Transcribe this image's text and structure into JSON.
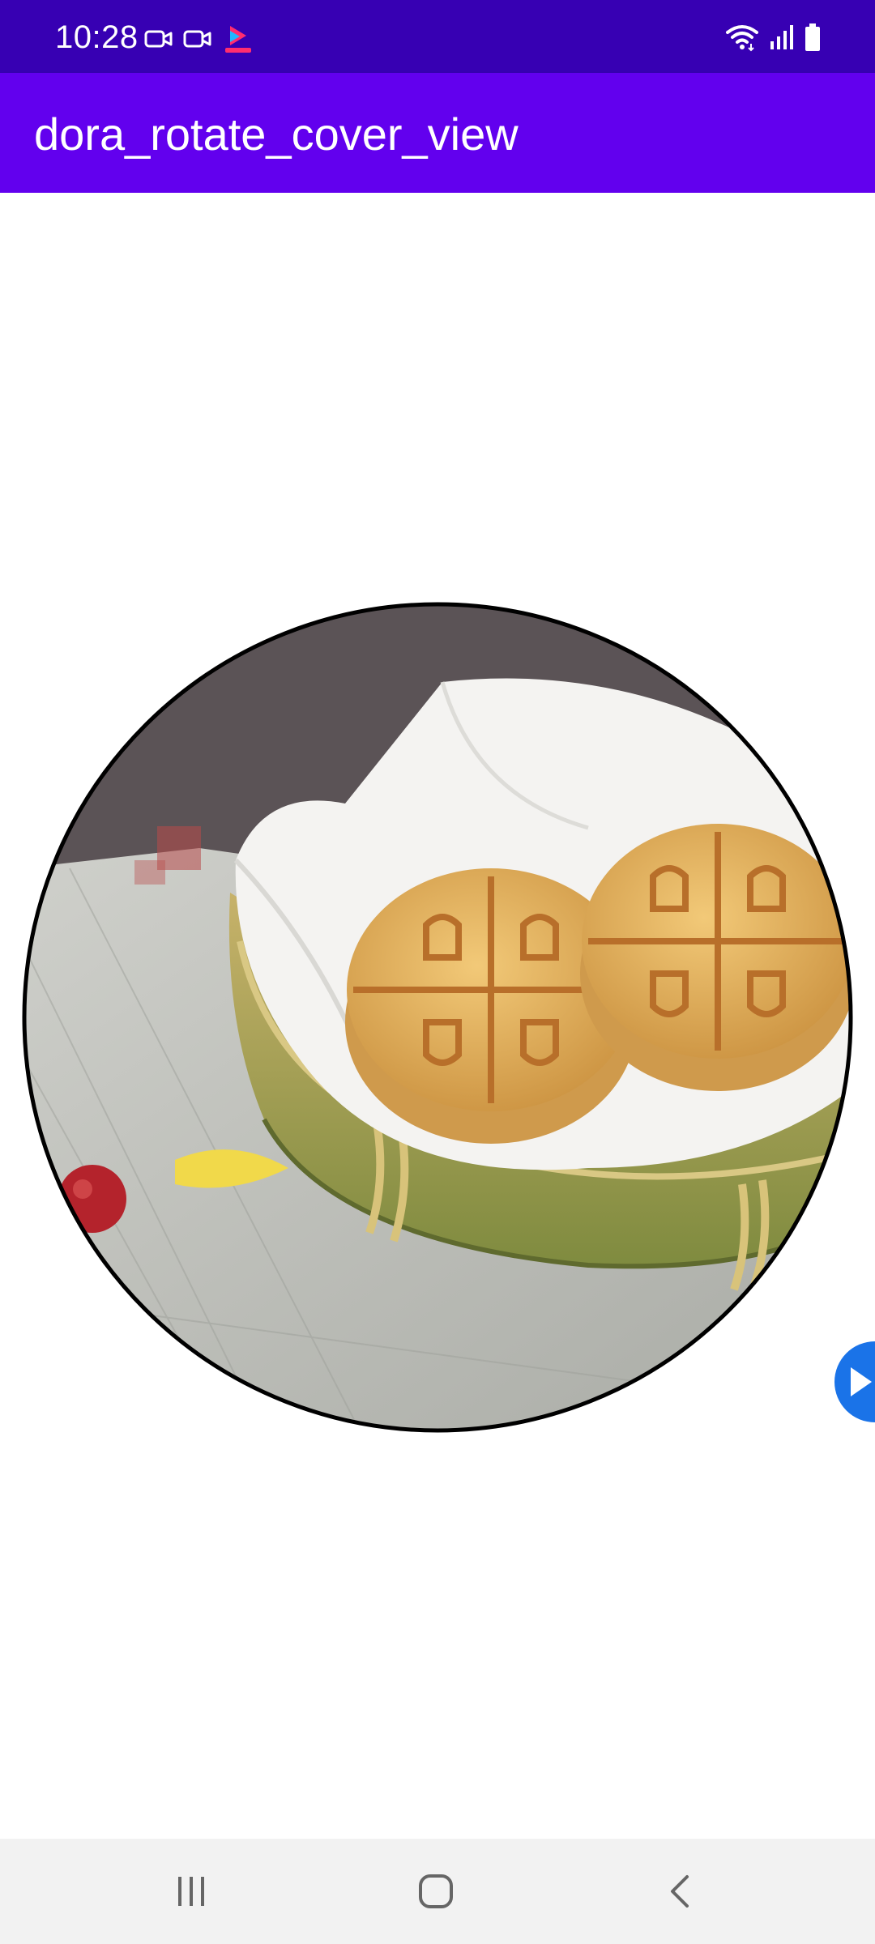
{
  "status_bar": {
    "time": "10:28",
    "left_icons": [
      "video-call-icon",
      "video-call-icon",
      "youku-app-icon"
    ],
    "right_icons": [
      "wifi-icon",
      "cell-signal-icon",
      "battery-icon"
    ],
    "bg_color": "#3700b3"
  },
  "app_bar": {
    "title": "dora_rotate_cover_view",
    "bg_color": "#6200ee"
  },
  "main": {
    "cover": {
      "description_icon": "rotating-circular-cover-image",
      "border_color": "#000000"
    },
    "floating_button": {
      "icon": "play-icon",
      "color": "#1a73e8"
    }
  },
  "nav_bar": {
    "buttons": [
      "recent-apps-icon",
      "home-icon",
      "back-icon"
    ],
    "bg_color": "#f2f2f2"
  }
}
